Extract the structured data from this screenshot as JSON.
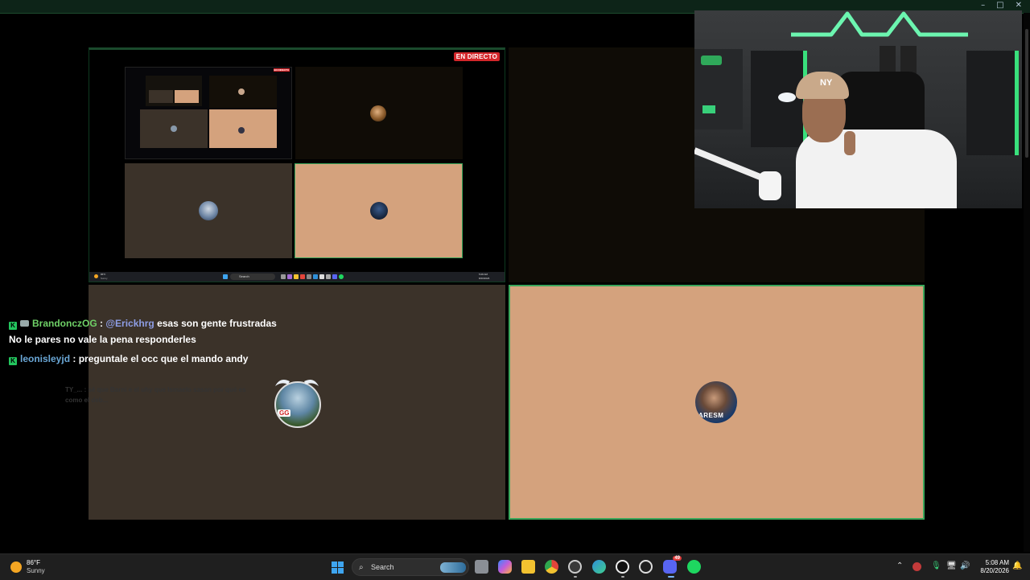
{
  "window": {
    "controls": [
      "–",
      "□",
      "✕"
    ]
  },
  "screen_share": {
    "live_badge": "EN DIRECTO",
    "inner_live_badge": "EN DIRECTO",
    "inner_search": "Search",
    "inner_clock_time": "5:08 AM",
    "inner_clock_date": "8/20/2026",
    "inner_weather_temp": "86°F",
    "inner_weather_cond": "Sunny"
  },
  "chat": {
    "messages": [
      {
        "user": "BrandonczOG",
        "sep": " : ",
        "mention": "@Erickhrg",
        "text": " esas son gente frustradas",
        "continuation": "No le pares no vale la pena responderles"
      },
      {
        "user": "leonisleyjd",
        "sep": " : ",
        "text": "preguntale el occ que el mando andy"
      }
    ],
    "faded_text": "TY_... : sé que Barni e el uhy que Ismaelo sasan por qué es como el deb..."
  },
  "avatars": {
    "brown_tile": "GG",
    "tan_tile": "ARESM"
  },
  "webcam": {
    "cap_logo": "NY"
  },
  "taskbar": {
    "weather_temp": "86°F",
    "weather_condition": "Sunny",
    "search_placeholder": "Search",
    "time": "5:08 AM",
    "date": "8/20/2026",
    "discord_badge": "49"
  },
  "colors": {
    "accent_green": "#3aa65a",
    "live_red": "#d3262a",
    "tan_tile": "#d4a27d",
    "brown_tile": "#3b3229"
  }
}
